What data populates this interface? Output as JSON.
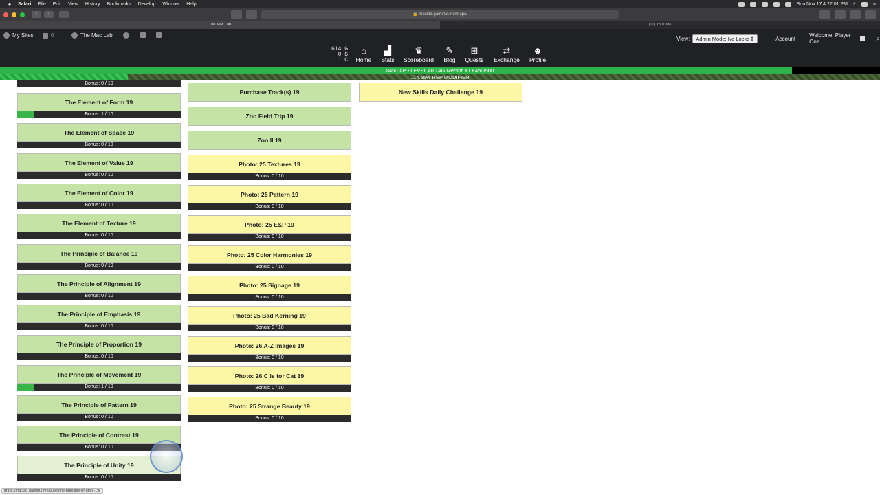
{
  "menubar": {
    "app": "Safari",
    "items": [
      "File",
      "Edit",
      "View",
      "History",
      "Bookmarks",
      "Develop",
      "Window",
      "Help"
    ],
    "datetime": "Sun Nov 17  4:27:01 PM"
  },
  "browser": {
    "url": "maclab.gameful.me/maps/",
    "tabs": [
      "The Mac Lab",
      "(10) YouTube"
    ]
  },
  "site": {
    "my_sites": "My Sites",
    "comments_count": "0",
    "site_name": "The Mac Lab",
    "currency": {
      "gold": "614 G",
      "silver": "0 S",
      "copper": "1 C"
    },
    "nav": [
      {
        "label": "Home",
        "icon": "home-icon",
        "glyph": "⌂"
      },
      {
        "label": "Stats",
        "icon": "stats-icon",
        "glyph": "▟"
      },
      {
        "label": "Scoreboard",
        "icon": "trophy-icon",
        "glyph": "♛"
      },
      {
        "label": "Blog",
        "icon": "pin-icon",
        "glyph": "✎"
      },
      {
        "label": "Quests",
        "icon": "sitemap-icon",
        "glyph": "⊞"
      },
      {
        "label": "Exchange",
        "icon": "exchange-icon",
        "glyph": "⇄"
      },
      {
        "label": "Profile",
        "icon": "profile-icon",
        "glyph": "☻"
      }
    ],
    "view_label": "View:",
    "view_mode": "Admin Mode: No Locks",
    "account": "Account",
    "welcome": "Welcome, Player One"
  },
  "xp": {
    "text": "8450 XP  •  LEVEL 40 TAG Mentor X1  •  450/500",
    "progress": 0.9,
    "rep_text": "114.55% REP MODIFIER",
    "rep_progress": 0.145,
    "fill_color": "#2db34a"
  },
  "quests": {
    "top_partial_bonus": "Bonus: 0 / 10",
    "column1": [
      {
        "name": "The Element of Form 19",
        "bonus": "Bonus: 1 / 10",
        "progress": 0.1
      },
      {
        "name": "The Element of Space 19",
        "bonus": "Bonus: 0 / 10",
        "progress": 0
      },
      {
        "name": "The Element of Value 19",
        "bonus": "Bonus: 0 / 10",
        "progress": 0
      },
      {
        "name": "The Element of Color 19",
        "bonus": "Bonus: 0 / 10",
        "progress": 0
      },
      {
        "name": "The Element of Texture 19",
        "bonus": "Bonus: 0 / 10",
        "progress": 0
      },
      {
        "name": "The Principle of Balance 19",
        "bonus": "Bonus: 0 / 10",
        "progress": 0
      },
      {
        "name": "The Principle of Alignment 19",
        "bonus": "Bonus: 0 / 10",
        "progress": 0
      },
      {
        "name": "The Principle of Emphasis 19",
        "bonus": "Bonus: 0 / 10",
        "progress": 0
      },
      {
        "name": "The Principle of Proportion 19",
        "bonus": "Bonus: 0 / 10",
        "progress": 0
      },
      {
        "name": "The Principle of Movement 19",
        "bonus": "Bonus: 1 / 10",
        "progress": 0.1
      },
      {
        "name": "The Principle of Pattern 19",
        "bonus": "Bonus: 0 / 10",
        "progress": 0
      },
      {
        "name": "The Principle of Contrast 19",
        "bonus": "Bonus: 0 / 10",
        "progress": 0
      },
      {
        "name": "The Principle of Unity 19",
        "bonus": "Bonus: 0 / 10",
        "progress": 0,
        "pale": true
      }
    ],
    "column2_green": [
      "Purchase Track(s) 19",
      "Zoo Field Trip 19",
      "Zoo II 19"
    ],
    "column2_yellow": [
      {
        "name": "Photo: 25 Textures 19",
        "bonus": "Bonus: 0 / 10"
      },
      {
        "name": "Photo: 25 Pattern 19",
        "bonus": "Bonus: 0 / 10"
      },
      {
        "name": "Photo: 25 E&P 19",
        "bonus": "Bonus: 0 / 10"
      },
      {
        "name": "Photo: 25 Color Harmonies 19",
        "bonus": "Bonus: 0 / 10"
      },
      {
        "name": "Photo: 25 Signage 19",
        "bonus": "Bonus: 0 / 10"
      },
      {
        "name": "Photo: 25 Bad Kerning 19",
        "bonus": "Bonus: 0 / 10"
      },
      {
        "name": "Photo: 26 A-Z Images 19",
        "bonus": "Bonus: 0 / 10"
      },
      {
        "name": "Photo: 26 C is for Cat 19",
        "bonus": "Bonus: 0 / 10"
      },
      {
        "name": "Photo: 25 Strange Beauty 19",
        "bonus": "Bonus: 0 / 10"
      }
    ],
    "column3": [
      "New Skills Daily Challenge 19"
    ]
  },
  "status_url": "https://maclab.gameful.me/tasks/the-principle-of-unity-19/"
}
